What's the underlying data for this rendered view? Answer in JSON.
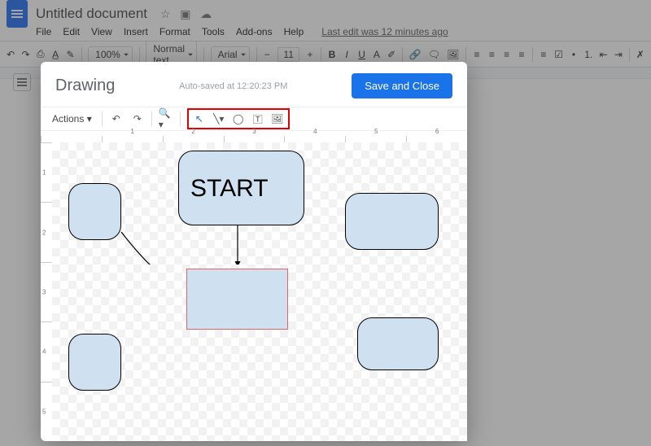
{
  "doc": {
    "title": "Untitled document",
    "last_edit": "Last edit was 12 minutes ago"
  },
  "menu": {
    "file": "File",
    "edit": "Edit",
    "view": "View",
    "insert": "Insert",
    "format": "Format",
    "tools": "Tools",
    "addons": "Add-ons",
    "help": "Help"
  },
  "toolbar": {
    "zoom": "100%",
    "style": "Normal text",
    "font": "Arial",
    "size": "11"
  },
  "drawing": {
    "title": "Drawing",
    "autosave": "Auto-saved at 12:20:23 PM",
    "save_close": "Save and Close",
    "actions": "Actions",
    "shapes": {
      "start_label": "START"
    },
    "ruler_h": [
      "1",
      "2",
      "3",
      "4",
      "5",
      "6"
    ],
    "ruler_v": [
      "1",
      "2",
      "3",
      "4",
      "5"
    ]
  }
}
